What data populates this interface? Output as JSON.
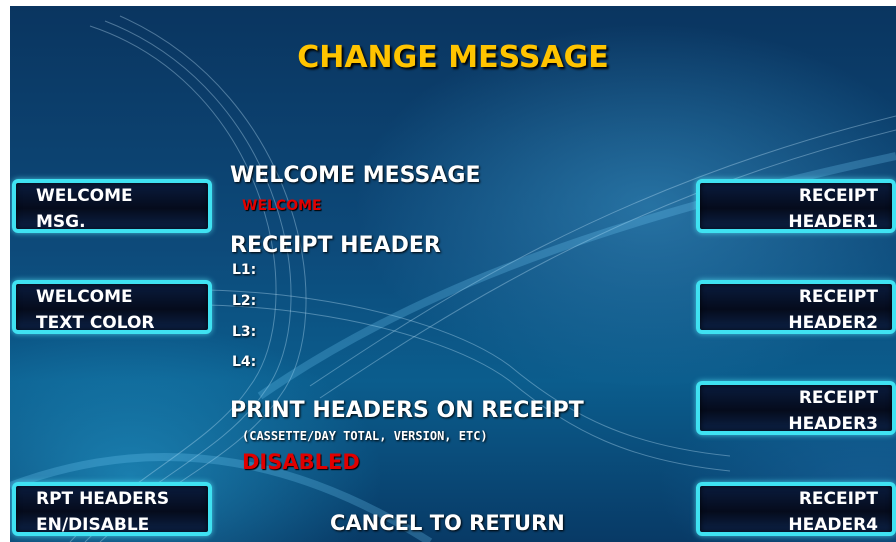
{
  "screen": {
    "title": "CHANGE MESSAGE",
    "cancel_hint": "CANCEL TO RETURN"
  },
  "left_buttons": [
    {
      "line1": "WELCOME",
      "line2": "MSG."
    },
    {
      "line1": "WELCOME",
      "line2": "TEXT COLOR"
    },
    {
      "line1": "RPT HEADERS",
      "line2": "EN/DISABLE"
    }
  ],
  "right_buttons": [
    {
      "line1": "RECEIPT",
      "line2": "HEADER1"
    },
    {
      "line1": "RECEIPT",
      "line2": "HEADER2"
    },
    {
      "line1": "RECEIPT",
      "line2": "HEADER3"
    },
    {
      "line1": "RECEIPT",
      "line2": "HEADER4"
    }
  ],
  "welcome": {
    "heading": "WELCOME MESSAGE",
    "value": "WELCOME",
    "value_color": "#e00000"
  },
  "receipt_header": {
    "heading": "RECEIPT HEADER",
    "lines": [
      "L1:",
      "L2:",
      "L3:",
      "L4:"
    ]
  },
  "print_headers": {
    "heading": "PRINT HEADERS ON RECEIPT",
    "note": "(CASSETTE/DAY TOTAL, VERSION, ETC)",
    "status": "DISABLED",
    "status_color": "#e00000"
  },
  "colors": {
    "title": "#ffc400",
    "button_border": "#3fe2f2",
    "background": "#0d4a7a"
  }
}
